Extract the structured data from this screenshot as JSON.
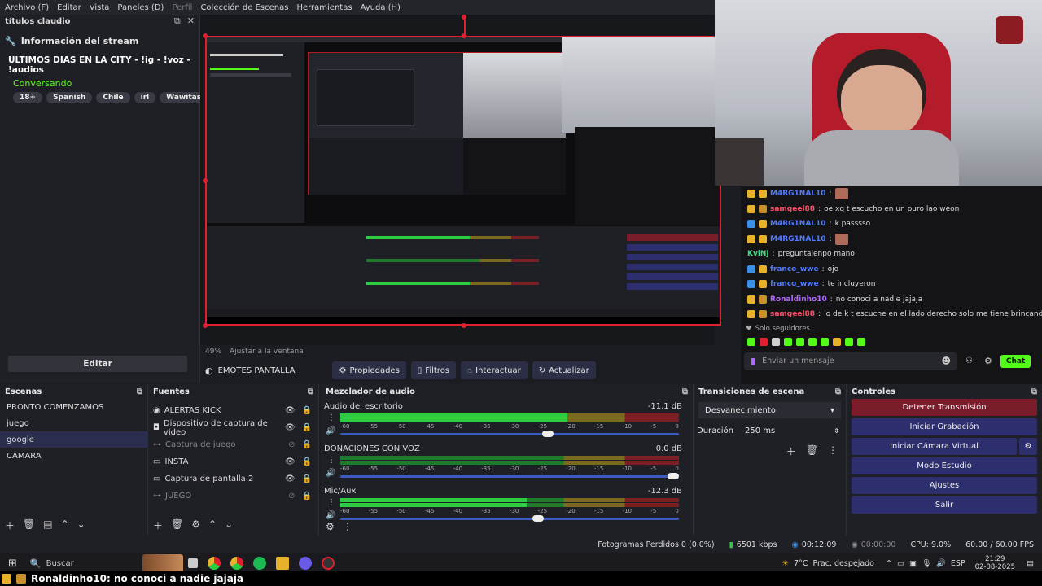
{
  "menu": [
    "Archivo (F)",
    "Editar",
    "Vista",
    "Paneles (D)",
    "Perfil",
    "Colección de Escenas",
    "Herramientas",
    "Ayuda (H)"
  ],
  "info_dock": {
    "header": "títulos claudio",
    "section": "Información del stream",
    "stream_title": "ULTIMOS DIAS EN LA CITY - !ig - !voz - !audios",
    "category": "Conversando",
    "tags": [
      "18+",
      "Spanish",
      "Chile",
      "irl",
      "WawitasRP"
    ],
    "edit_button": "Editar"
  },
  "preview": {
    "zoom": "49%",
    "fit": "Ajustar a la ventana",
    "ticker_overlay": "Ronaldinho10: no conoci a nadie jajaja"
  },
  "source_toolbar": {
    "source_name": "EMOTES PANTALLA",
    "properties": "Propiedades",
    "filters": "Filtros",
    "interact": "Interactuar",
    "refresh": "Actualizar"
  },
  "chat": {
    "messages": [
      {
        "user": "M4RG1NAL10",
        "text": "",
        "color": "#4f7bff",
        "badges": [
          "#e8b12b",
          "#e8b12b"
        ]
      },
      {
        "user": "samgeel88",
        "text": "oe xq t escucho en un puro lao weon",
        "color": "#ff4f6a",
        "badges": [
          "#e8b12b",
          "#c88f2a"
        ]
      },
      {
        "user": "M4RG1NAL10",
        "text": "k passsso",
        "color": "#4f7bff",
        "badges": [
          "#3a8fe8",
          "#e8b12b"
        ]
      },
      {
        "user": "M4RG1NAL10",
        "text": "",
        "color": "#4f7bff",
        "badges": [
          "#e8b12b",
          "#e8b12b"
        ]
      },
      {
        "user": "KviNj",
        "text": "preguntalenpo mano",
        "color": "#3ddc84",
        "badges": []
      },
      {
        "user": "franco_wwe",
        "text": "ojo",
        "color": "#4f7bff",
        "badges": [
          "#3a8fe8",
          "#e8b12b"
        ]
      },
      {
        "user": "franco_wwe",
        "text": "te incluyeron",
        "color": "#4f7bff",
        "badges": [
          "#3a8fe8",
          "#e8b12b"
        ]
      },
      {
        "user": "Ronaldinho10",
        "text": "no conoci a nadie jajaja",
        "color": "#b069ff",
        "badges": [
          "#e8b12b",
          "#c88f2a"
        ]
      },
      {
        "user": "samgeel88",
        "text": "lo de k t escuche en el lado derecho solo me tiene brincando",
        "color": "#ff4f6a",
        "badges": [
          "#e8b12b",
          "#c88f2a"
        ]
      }
    ],
    "followers_only": "Solo seguidores",
    "input_placeholder": "Enviar un mensaje",
    "send_button": "Chat"
  },
  "scenes": {
    "title": "Escenas",
    "items": [
      "PRONTO COMENZAMOS",
      "juego",
      "google",
      "CAMARA"
    ],
    "selected": 2
  },
  "sources": {
    "title": "Fuentes",
    "items": [
      {
        "name": "ALERTAS KICK",
        "visible": true
      },
      {
        "name": "Dispositivo de captura de video",
        "visible": true
      },
      {
        "name": "Captura de juego",
        "visible": false
      },
      {
        "name": "INSTA",
        "visible": true
      },
      {
        "name": "Captura de pantalla 2",
        "visible": true
      },
      {
        "name": "JUEGO",
        "visible": false
      }
    ]
  },
  "mixer": {
    "title": "Mezclador de audio",
    "channels": [
      {
        "name": "Audio del escritorio",
        "db": "-11.1 dB",
        "level": 0.67,
        "fader": 0.63
      },
      {
        "name": "DONACIONES CON VOZ",
        "db": "0.0 dB",
        "level": 0.0,
        "fader": 1.0
      },
      {
        "name": "Mic/Aux",
        "db": "-12.3 dB",
        "level": 0.55,
        "fader": 0.6
      }
    ],
    "scale": [
      "-60",
      "-55",
      "-50",
      "-45",
      "-40",
      "-35",
      "-30",
      "-25",
      "-20",
      "-15",
      "-10",
      "-5",
      "0"
    ]
  },
  "transitions": {
    "title": "Transiciones de escena",
    "type": "Desvanecimiento",
    "duration_label": "Duración",
    "duration_value": "250 ms"
  },
  "controls": {
    "title": "Controles",
    "stop_stream": "Detener Transmisión",
    "start_recording": "Iniciar Grabación",
    "virtual_cam": "Iniciar Cámara Virtual",
    "studio_mode": "Modo Estudio",
    "settings": "Ajustes",
    "exit": "Salir"
  },
  "status": {
    "dropped": "Fotogramas Perdidos 0 (0.0%)",
    "bitrate": "6501 kbps",
    "stream_time": "00:12:09",
    "rec_time": "00:00:00",
    "cpu": "CPU: 9.0%",
    "fps": "60.00 / 60.00 FPS"
  },
  "taskbar": {
    "search": "Buscar",
    "weather": "7°C",
    "weather_desc": "Prac. despejado",
    "lang": "ESP",
    "time": "21:29",
    "date": "02-08-2025"
  },
  "colors": {
    "accent": "#2c2e6e",
    "stop_red": "#7a1c2a",
    "selection_red": "#e0202e",
    "chat_green": "#53fc18"
  }
}
